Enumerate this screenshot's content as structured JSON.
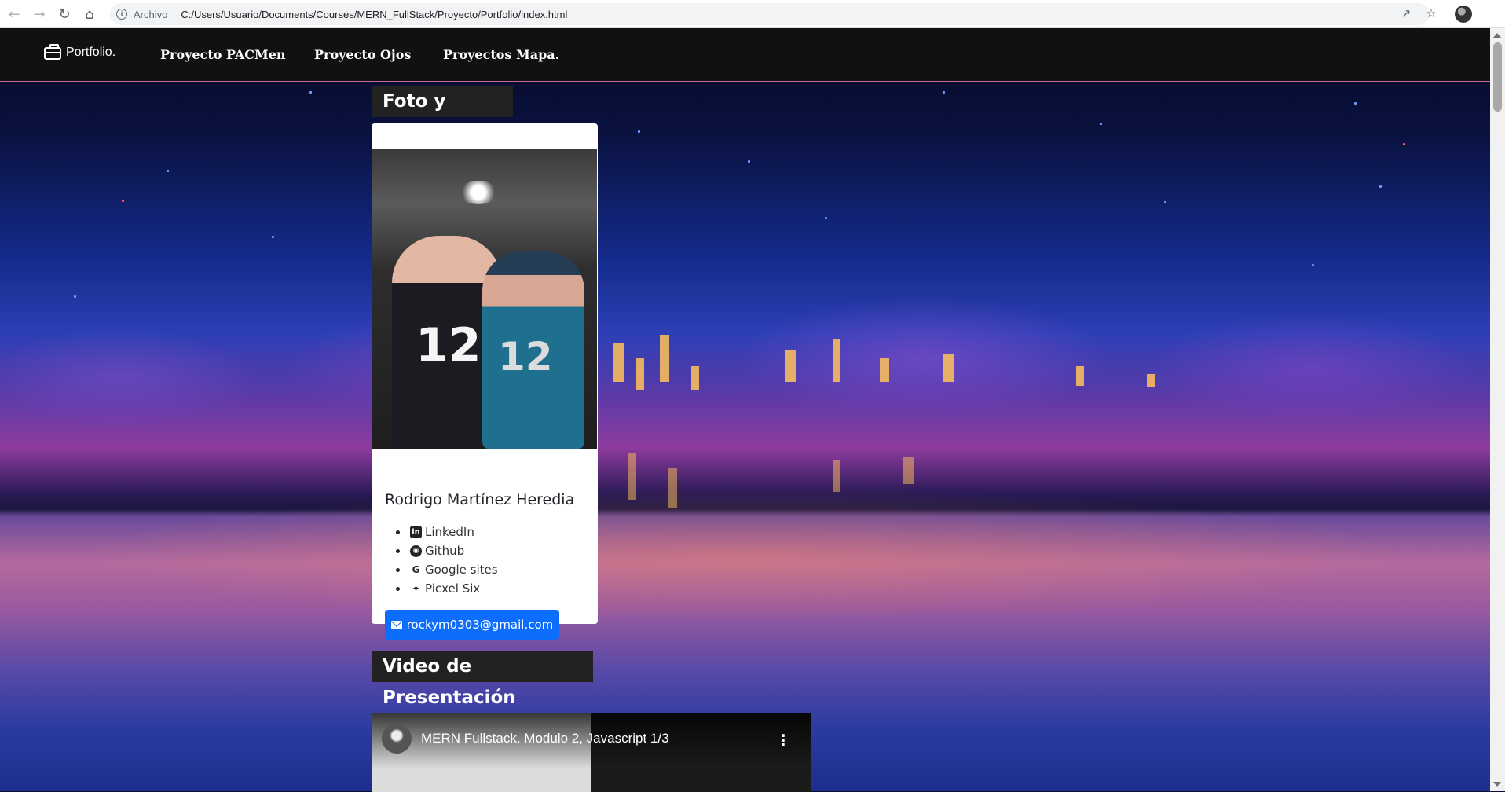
{
  "browser": {
    "scheme_label": "Archivo",
    "url": "C:/Users/Usuario/Documents/Courses/MERN_FullStack/Proyecto/Portfolio/index.html",
    "icons": [
      "back-icon",
      "forward-icon",
      "reload-icon",
      "home-icon",
      "info-icon",
      "share-icon",
      "star-icon",
      "profile-avatar"
    ]
  },
  "navbar": {
    "brand": "Portfolio.",
    "links": [
      "Proyecto PACMen",
      "Proyecto Ojos",
      "Proyectos Mapa."
    ]
  },
  "profile_section": {
    "title": "Foto y Datos.",
    "name": "Rodrigo Martínez Heredia",
    "links": [
      {
        "label": "LinkedIn",
        "icon": "linkedin-icon"
      },
      {
        "label": "Github",
        "icon": "github-icon"
      },
      {
        "label": "Google sites",
        "icon": "google-icon"
      },
      {
        "label": "Picxel Six",
        "icon": "twitter-icon"
      }
    ],
    "email": "rockym0303@gmail.com",
    "photo_numbers": [
      "12",
      "12"
    ]
  },
  "video_section": {
    "title": "Video de Presentación",
    "video_title": "MERN Fullstack. Modulo 2, Javascript 1/3",
    "menu_glyph": "⋮"
  },
  "colors": {
    "navbar_bg": "#111111",
    "section_title_bg": "#222222",
    "email_button": "#0d6efd"
  }
}
